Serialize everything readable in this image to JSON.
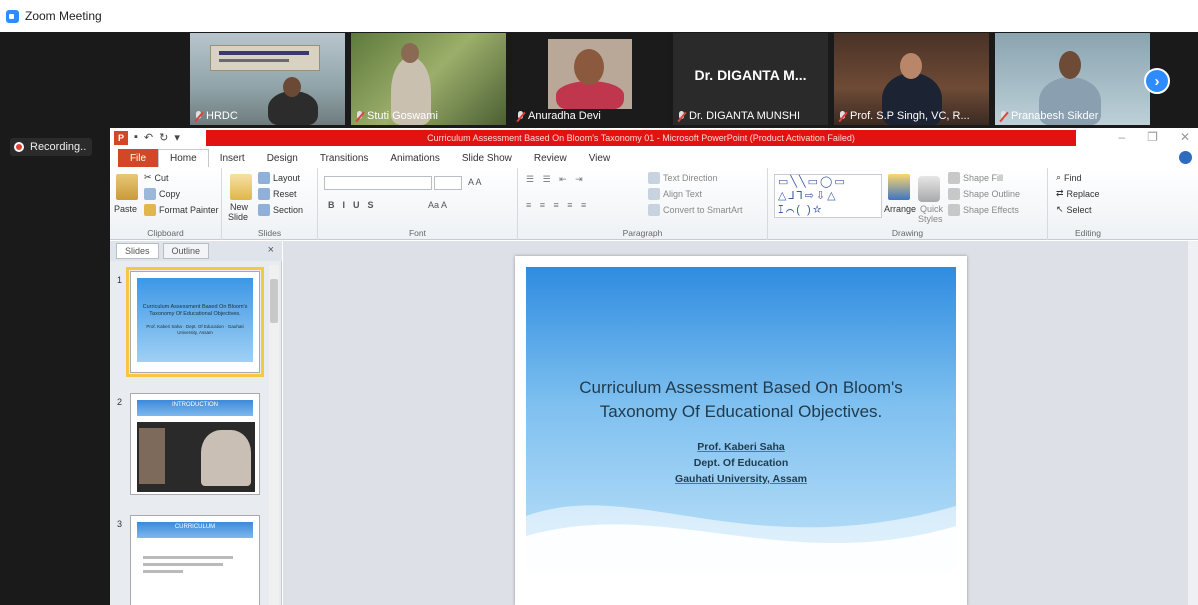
{
  "zoom": {
    "window_title": "Zoom Meeting",
    "recording_label": "Recording..",
    "participants": [
      {
        "name": "HRDC"
      },
      {
        "name": "Stuti Goswami"
      },
      {
        "name": "Anuradha Devi"
      },
      {
        "name": "Dr. DIGANTA MUNSHI",
        "tile_text": "Dr. DIGANTA M..."
      },
      {
        "name": "Prof. S.P Singh, VC, R..."
      },
      {
        "name": "Pranabesh Sikder"
      }
    ],
    "next_icon": "chevron-right-icon"
  },
  "ppt": {
    "title": "Curriculum Assessment Based On Bloom's Taxonomy 01 - Microsoft PowerPoint (Product Activation Failed)",
    "tabs": [
      "File",
      "Home",
      "Insert",
      "Design",
      "Transitions",
      "Animations",
      "Slide Show",
      "Review",
      "View"
    ],
    "ribbon": {
      "clipboard": {
        "paste": "Paste",
        "cut": "Cut",
        "copy": "Copy",
        "format_painter": "Format Painter",
        "label": "Clipboard"
      },
      "slides": {
        "new_slide_1": "New",
        "new_slide_2": "Slide",
        "layout": "Layout",
        "reset": "Reset",
        "section": "Section",
        "label": "Slides"
      },
      "font": {
        "label": "Font"
      },
      "paragraph": {
        "text_direction": "Text Direction",
        "align_text": "Align Text",
        "convert": "Convert to SmartArt",
        "label": "Paragraph"
      },
      "drawing": {
        "arrange": "Arrange",
        "quick_styles_1": "Quick",
        "quick_styles_2": "Styles",
        "shape_fill": "Shape Fill",
        "shape_outline": "Shape Outline",
        "shape_effects": "Shape Effects",
        "label": "Drawing"
      },
      "editing": {
        "find": "Find",
        "replace": "Replace",
        "select": "Select",
        "label": "Editing"
      }
    },
    "pane": {
      "tab_slides": "Slides",
      "tab_outline": "Outline"
    },
    "thumbnails": [
      {
        "num": "1",
        "title": "Curriculum Assessment Based On Bloom's Taxonomy Of Educational Objectives.",
        "sub": "Prof. Kaberi Saha · Dept. Of Education · Gauhati University, Assam"
      },
      {
        "num": "2",
        "heading": "INTRODUCTION"
      },
      {
        "num": "3",
        "heading": "CURRICULUM"
      }
    ],
    "slide": {
      "title_line1": "Curriculum Assessment  Based On Bloom's",
      "title_line2": "Taxonomy Of Educational Objectives.",
      "author": "Prof. Kaberi Saha",
      "dept": "Dept. Of Education",
      "university": "Gauhati University, Assam"
    }
  }
}
